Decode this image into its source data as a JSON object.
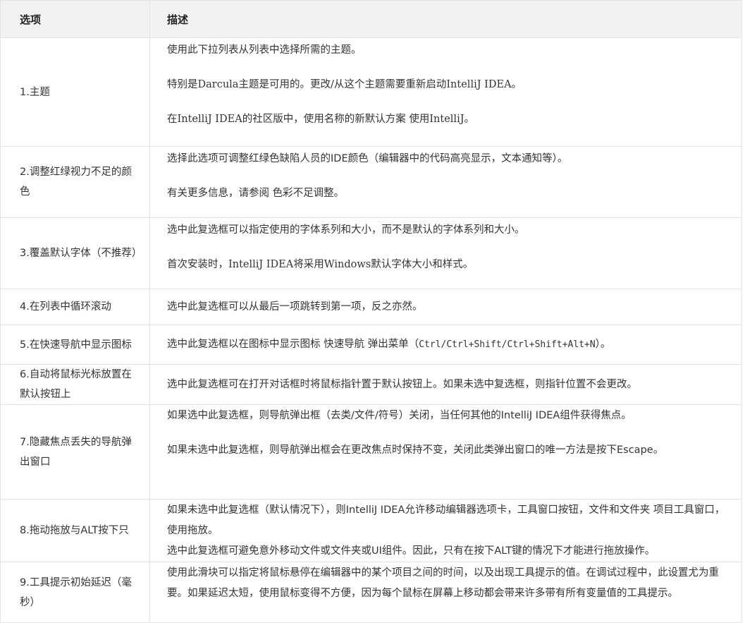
{
  "table": {
    "header": {
      "option": "选项",
      "description": "描述"
    },
    "rows": [
      {
        "option": "1.主题",
        "paragraphs": [
          "使用此下拉列表从列表中选择所需的主题。",
          "特别是Darcula主题是可用的。更改/从这个主题需要重新启动IntelliJ IDEA。",
          "在IntelliJ IDEA的社区版中，使用名称的新默认方案 使用IntelliJ。"
        ]
      },
      {
        "option": "2.调整红绿视力不足的颜色",
        "paragraphs": [
          "选择此选项可调整红绿色缺陷人员的IDE颜色（编辑器中的代码高亮显示，文本通知等）。",
          "有关更多信息，请参阅 色彩不足调整。"
        ]
      },
      {
        "option": "3.覆盖默认字体（不推荐）",
        "paragraphs": [
          "选中此复选框可以指定使用的字体系列和大小，而不是默认的字体系列和大小。",
          "首次安装时，IntelliJ IDEA将采用Windows默认字体大小和样式。"
        ]
      },
      {
        "option": "4.在列表中循环滚动",
        "paragraphs": [
          "选中此复选框可以从最后一项跳转到第一项，反之亦然。"
        ]
      },
      {
        "option": "5.在快速导航中显示图标",
        "desc_prefix": "选中此复选框以在图标中显示图标 快速导航 弹出菜单（",
        "desc_code": "Ctrl/Ctrl+Shift/Ctrl+Shift+Alt+N",
        "desc_suffix": "）。"
      },
      {
        "option": "6.自动将鼠标光标放置在默认按钮上",
        "paragraphs": [
          "选中此复选框可在打开对话框时将鼠标指针置于默认按钮上。如果未选中复选框，则指针位置不会更改。"
        ]
      },
      {
        "option": "7.隐藏焦点丢失的导航弹出窗口",
        "paragraphs": [
          "如果选中此复选框，则导航弹出框（去类/文件/符号）关闭，当任何其他的IntelliJ IDEA组件获得焦点。",
          "如果未选中此复选框，则导航弹出框会在更改焦点时保持不变，关闭此类弹出窗口的唯一方法是按下Escape。"
        ]
      },
      {
        "option": "8.拖动拖放与ALT按下只",
        "lines": [
          "如果未选中此复选框（默认情况下），则IntelliJ IDEA允许移动编辑器选项卡，工具窗口按钮，文件和文件夹 项目工具窗口，使用拖放。",
          "选中此复选框可避免意外移动文件或文件夹或UI组件。因此，只有在按下ALT键的情况下才能进行拖放操作。"
        ]
      },
      {
        "option": "9.工具提示初始延迟（毫秒）",
        "lines": [
          "使用此滑块可以指定将鼠标悬停在编辑器中的某个项目之间的时间，以及出现工具提示的值。在调试过程中，此设置尤为重要。如果延迟太短，使用鼠标变得不方便，因为每个鼠标在屏幕上移动都会带来许多带有所有变量值的工具提示。"
        ]
      }
    ]
  }
}
